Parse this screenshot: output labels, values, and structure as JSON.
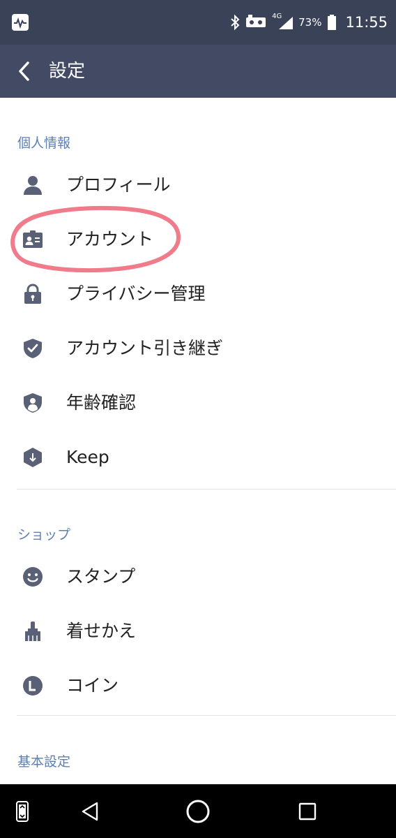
{
  "status_bar": {
    "network": "4G",
    "battery_percent": "73%",
    "time": "11:55"
  },
  "app_bar": {
    "title": "設定"
  },
  "sections": {
    "personal": {
      "header": "個人情報",
      "items": [
        {
          "label": "プロフィール",
          "icon": "person-icon"
        },
        {
          "label": "アカウント",
          "icon": "id-card-icon"
        },
        {
          "label": "プライバシー管理",
          "icon": "lock-icon"
        },
        {
          "label": "アカウント引き継ぎ",
          "icon": "shield-check-icon"
        },
        {
          "label": "年齢確認",
          "icon": "shield-person-icon"
        },
        {
          "label": "Keep",
          "icon": "keep-download-icon"
        }
      ]
    },
    "shop": {
      "header": "ショップ",
      "items": [
        {
          "label": "スタンプ",
          "icon": "smiley-icon"
        },
        {
          "label": "着せかえ",
          "icon": "brush-icon"
        },
        {
          "label": "コイン",
          "icon": "coin-icon"
        }
      ]
    },
    "basic": {
      "header": "基本設定"
    }
  },
  "colors": {
    "status_bar": "#3a4257",
    "app_bar": "#434b64",
    "section_header": "#5f7fb0",
    "icon": "#5a6075",
    "highlight": "#f07b8a"
  }
}
